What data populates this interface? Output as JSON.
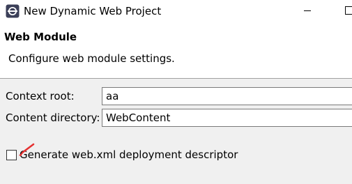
{
  "window": {
    "title": "New Dynamic Web Project"
  },
  "header": {
    "section_title": "Web Module",
    "description": "Configure web module settings."
  },
  "form": {
    "context_root": {
      "label": "Context root:",
      "value": "aa"
    },
    "content_directory": {
      "label": "Content directory:",
      "value": "WebContent"
    },
    "generate_descriptor": {
      "label": "Generate web.xml deployment descriptor",
      "checked": false
    }
  },
  "icons": [
    "eclipse-app-icon",
    "minimize-icon",
    "maximize-icon",
    "annotation-arrow-icon"
  ],
  "colors": {
    "background": "#f0f0f0",
    "panel": "#ffffff",
    "divider": "#a0a0a0",
    "arrow": "#e53030"
  }
}
